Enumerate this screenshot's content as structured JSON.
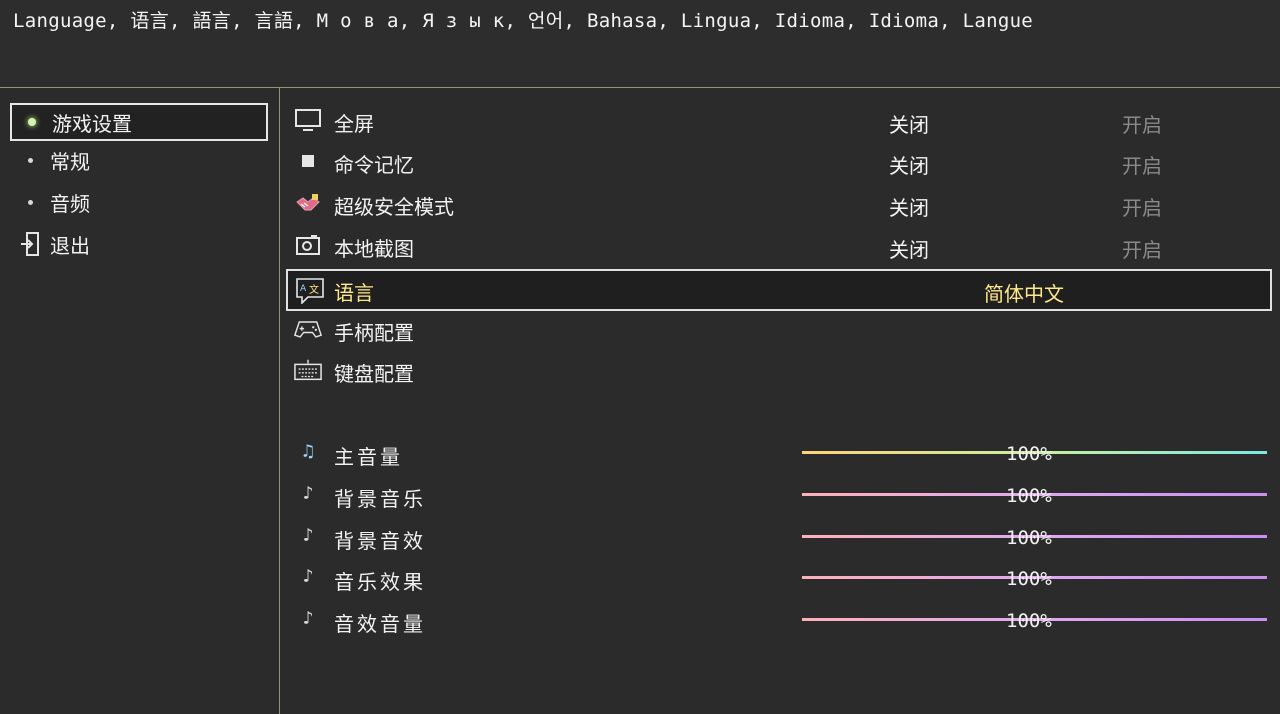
{
  "header": {
    "languages_text": "Language, 语言, 語言, 言語, М о в а, Я з ы к, 언어, Bahasa, Lingua, Idioma, Idioma, Langue"
  },
  "sidebar": {
    "items": [
      {
        "label": "游戏设置",
        "selected": true
      },
      {
        "label": "常规"
      },
      {
        "label": "音频"
      },
      {
        "label": "退出",
        "icon": "exit-door-icon"
      }
    ]
  },
  "settings": {
    "off_label": "关闭",
    "on_label": "开启",
    "rows": [
      {
        "label": "全屏",
        "icon": "monitor-icon"
      },
      {
        "label": "命令记忆",
        "icon": "square-icon"
      },
      {
        "label": "超级安全模式",
        "icon": "handshake-icon"
      },
      {
        "label": "本地截图",
        "icon": "camera-icon"
      }
    ],
    "language": {
      "label": "语言",
      "icon": "translate-icon",
      "value": "简体中文"
    },
    "gamepad": {
      "label": "手柄配置",
      "icon": "gamepad-icon"
    },
    "keyboard": {
      "label": "键盘配置",
      "icon": "keyboard-icon"
    }
  },
  "audio": {
    "rows": [
      {
        "label": "主音量",
        "icon": "music-note-icon",
        "value": "100%",
        "level": 1.0
      },
      {
        "label": "背景音乐",
        "icon": "music-note-small-icon",
        "value": "100%",
        "level": 1.0
      },
      {
        "label": "背景音效",
        "icon": "music-note-small-icon",
        "value": "100%",
        "level": 1.0
      },
      {
        "label": "音乐效果",
        "icon": "music-note-small-icon",
        "value": "100%",
        "level": 1.0
      },
      {
        "label": "音效音量",
        "icon": "music-note-small-icon",
        "value": "100%",
        "level": 1.0
      }
    ]
  },
  "colors": {
    "background": "#2b2b2b",
    "divider": "#8a9a6e",
    "highlight_text": "#ffe98a",
    "master_slider_gradient": [
      "#ffd27a",
      "#c8f0a0",
      "#7de8e0"
    ],
    "sub_slider_gradient": [
      "#ffb0b8",
      "#e0a8f0",
      "#c890f0"
    ]
  }
}
